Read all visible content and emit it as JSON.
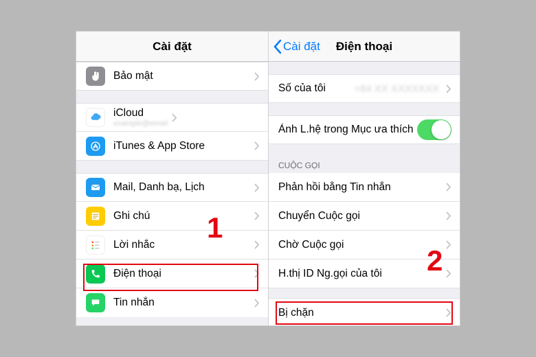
{
  "left": {
    "title": "Cài đặt",
    "privacy": "Bảo mật",
    "icloud": "iCloud",
    "icloud_detail": "example@email",
    "itunes": "iTunes & App Store",
    "mail": "Mail, Danh bạ, Lịch",
    "notes": "Ghi chú",
    "reminders": "Lời nhắc",
    "phone": "Điện thoại",
    "messages": "Tin nhắn"
  },
  "right": {
    "back": "Cài đặt",
    "title": "Điện thoại",
    "mynumber_label": "Số của tôi",
    "mynumber_value": "+84 XX XXXXXXX",
    "favorites_photo": "Ảnh L.hệ trong Mục ưa thích",
    "section_calls": "CUỘC GỌI",
    "reply_msg": "Phản hồi bằng Tin nhắn",
    "call_fwd": "Chuyển Cuộc gọi",
    "call_wait": "Chờ Cuộc gọi",
    "caller_id": "H.thị ID Ng.gọi của tôi",
    "blocked": "Bị chặn"
  },
  "annotations": {
    "step1": "1",
    "step2": "2"
  }
}
